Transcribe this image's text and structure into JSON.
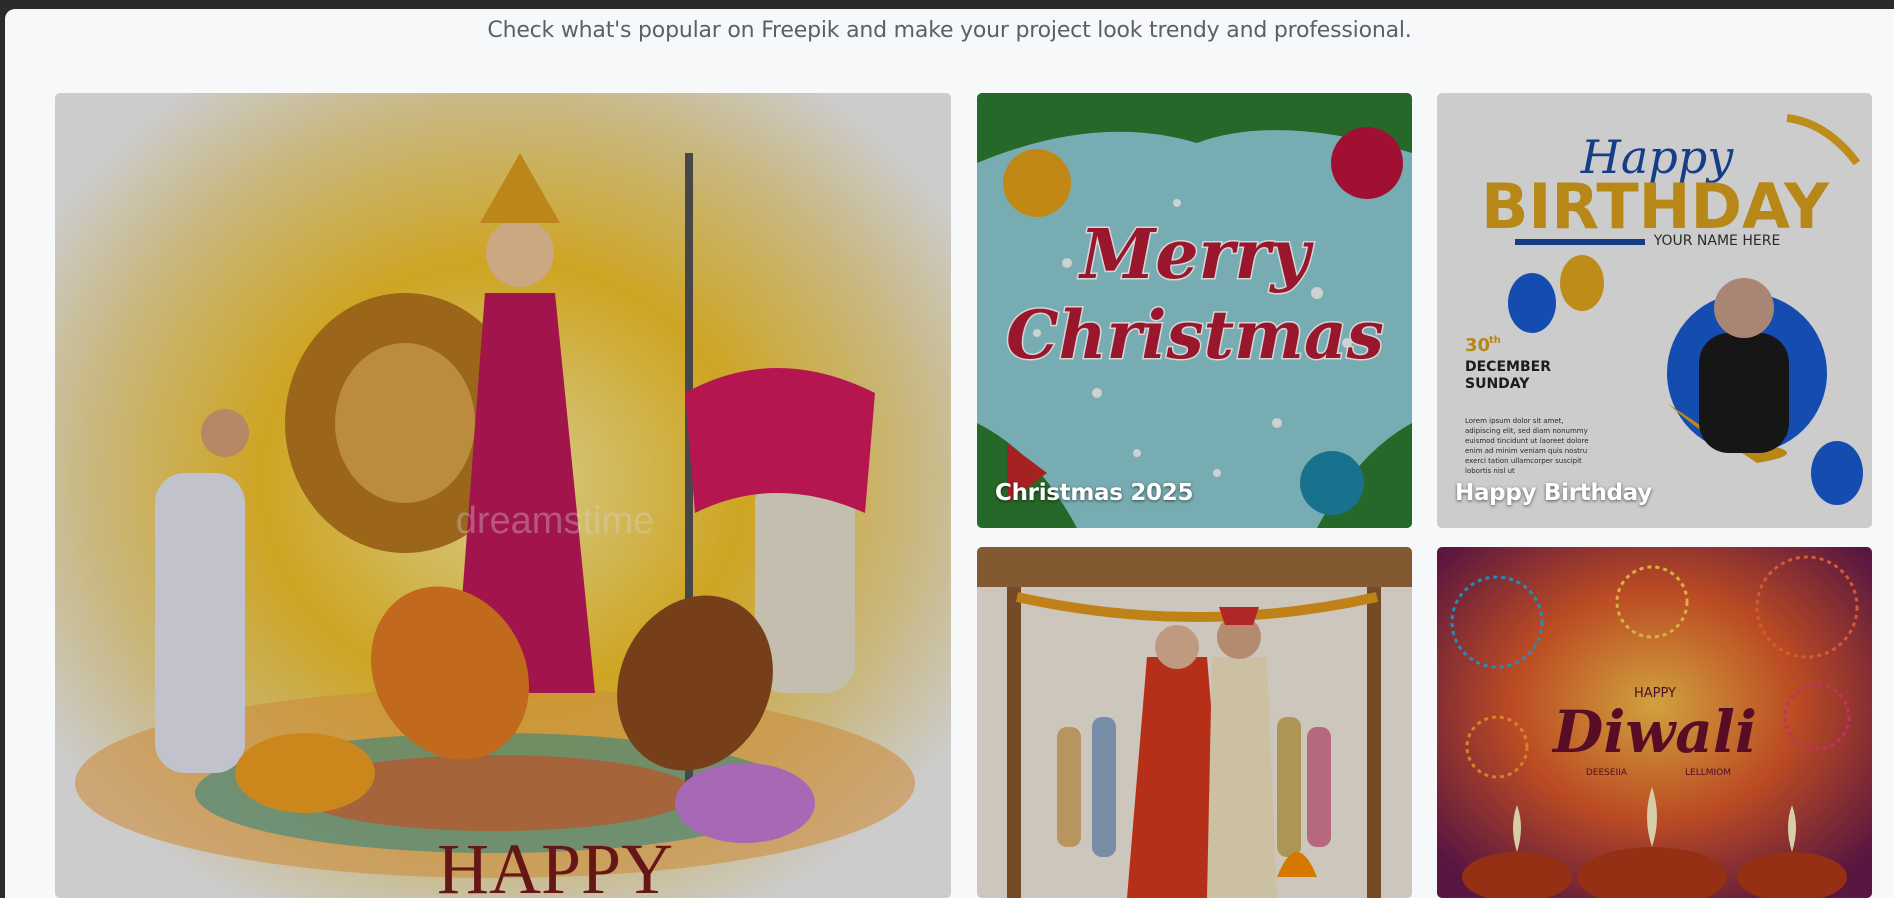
{
  "header": {
    "subtitle": "Check what's popular on Freepik and make your project look trendy and professional."
  },
  "cards": [
    {
      "label": "",
      "image_text": "HAPPY",
      "watermark": "dreamstime"
    },
    {
      "label": "Christmas 2025",
      "image_text_1": "Merry",
      "image_text_2": "Christmas"
    },
    {
      "label": "Happy Birthday",
      "image_text_script": "Happy",
      "image_text_title": "BIRTHDAY",
      "image_text_name": "YOUR NAME HERE",
      "date_day": "30",
      "date_suffix": "th",
      "date_month": "DECEMBER",
      "date_weekday": "SUNDAY",
      "lorem_1": "Lorem ipsum dolor sit amet,",
      "lorem_2": "adipiscing elit, sed diam nonummy",
      "lorem_3": "euismod tincidunt ut laoreet dolore",
      "lorem_4": "enim ad minim veniam quis nostru",
      "lorem_5": "exerci tation ullamcorper suscipit",
      "lorem_6": "lobortis nisl ut"
    },
    {
      "label": ""
    },
    {
      "label": "",
      "image_text_small": "HAPPY",
      "image_text_script": "Diwali",
      "image_text_sub_1": "DEESEIIA",
      "image_text_sub_2": "LELLMIOM"
    }
  ],
  "colors": {
    "page_bg": "#f7f8fa",
    "frame_bg": "#2b2b2b",
    "label": "#ffffff"
  },
  "icons": [
    "shadow-overlay"
  ]
}
